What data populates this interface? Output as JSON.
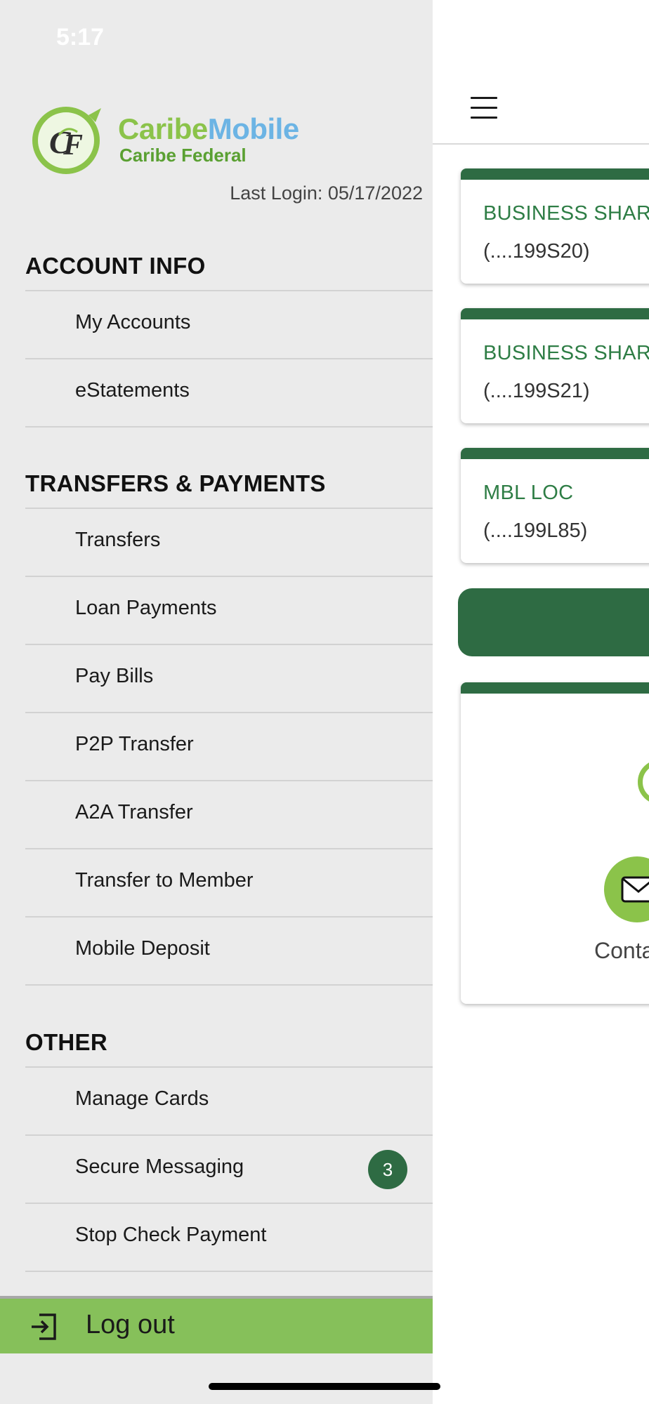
{
  "status_bar": {
    "time": "5:17"
  },
  "drawer": {
    "brand": {
      "part1": "Caribe",
      "part2": "Mobile",
      "subtitle": "Caribe Federal"
    },
    "last_login": "Last Login:  05/17/2022",
    "sections": {
      "account_info": {
        "title": "ACCOUNT INFO",
        "items": [
          "My Accounts",
          "eStatements"
        ]
      },
      "transfers": {
        "title": "TRANSFERS & PAYMENTS",
        "items": [
          "Transfers",
          "Loan Payments",
          "Pay Bills",
          "P2P Transfer",
          "A2A Transfer",
          "Transfer to Member",
          "Mobile Deposit"
        ]
      },
      "other": {
        "title": "OTHER",
        "items": [
          "Manage Cards",
          "Secure Messaging",
          "Stop Check Payment"
        ]
      }
    },
    "secure_messaging_badge": "3",
    "logout_label": "Log out"
  },
  "main": {
    "accounts": [
      {
        "name": "BUSINESS SHAR",
        "number": "(....199S20)"
      },
      {
        "name": "BUSINESS SHAR",
        "number": "(....199S21)"
      },
      {
        "name": "MBL LOC",
        "number": "(....199L85)"
      }
    ],
    "contact_label": "Conta"
  },
  "colors": {
    "brand_green": "#8bc34a",
    "dark_green": "#2e6b43",
    "brand_blue": "#6cb4e4",
    "drawer_bg": "#ebebeb",
    "logout_bg": "#86c05a"
  },
  "icons": [
    "hamburger-menu-icon",
    "caribe-federal-logo",
    "envelope-icon",
    "logout-icon"
  ]
}
